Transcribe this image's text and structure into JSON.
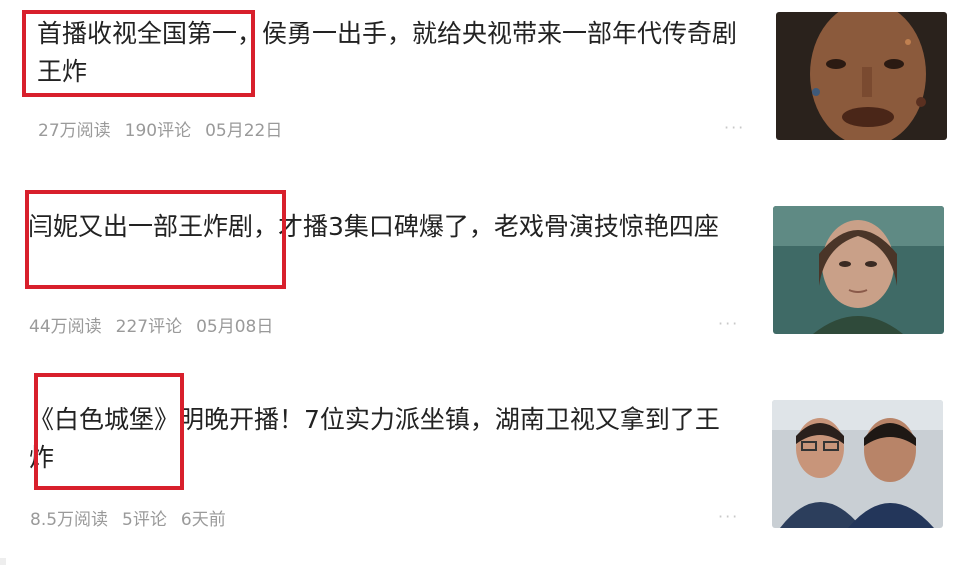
{
  "feed": {
    "items": [
      {
        "title": "首播收视全国第一，侯勇一出手，就给央视带来一部年代传奇剧王炸",
        "reads": "27万阅读",
        "comments": "190评论",
        "date": "05月22日",
        "more": "···",
        "thumbnail": "actor-closeup"
      },
      {
        "title": "闫妮又出一部王炸剧，才播3集口碑爆了，老戏骨演技惊艳四座",
        "reads": "44万阅读",
        "comments": "227评论",
        "date": "05月08日",
        "more": "···",
        "thumbnail": "actress-portrait"
      },
      {
        "title": "《白色城堡》明晚开播！7位实力派坐镇，湖南卫视又拿到了王炸",
        "reads": "8.5万阅读",
        "comments": "5评论",
        "date": "6天前",
        "more": "···",
        "thumbnail": "two-doctors"
      }
    ]
  },
  "colors": {
    "highlight_border": "#d8202c",
    "title_text": "#222222",
    "meta_text": "#9a9a9a"
  }
}
